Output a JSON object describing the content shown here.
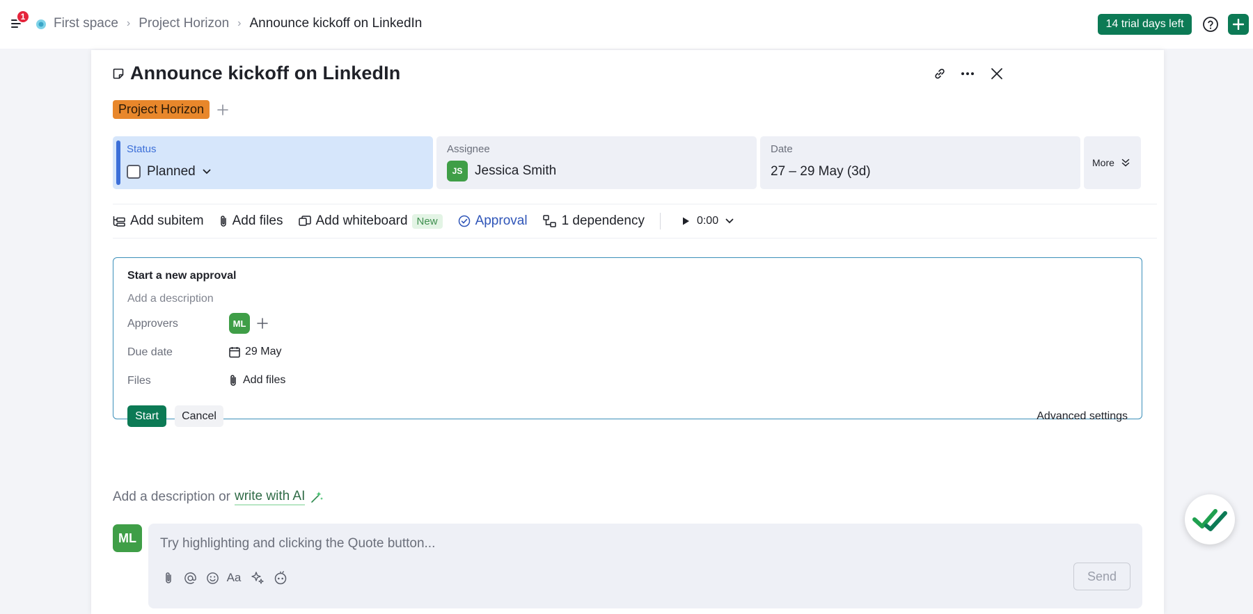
{
  "topbar": {
    "notification_count": "1",
    "breadcrumb": [
      "First space",
      "Project Horizon",
      "Announce kickoff on LinkedIn"
    ],
    "trial_label": "14 trial days left"
  },
  "task": {
    "title": "Announce kickoff on LinkedIn",
    "tag": "Project Horizon",
    "tag_color": "#e8872b"
  },
  "fields": {
    "status": {
      "label": "Status",
      "value": "Planned"
    },
    "assignee": {
      "label": "Assignee",
      "initials": "JS",
      "value": "Jessica Smith"
    },
    "date": {
      "label": "Date",
      "value": "27 – 29 May (3d)"
    },
    "more": {
      "label": "More"
    }
  },
  "toolbar": {
    "add_subitem": "Add subitem",
    "add_files": "Add files",
    "add_whiteboard": "Add whiteboard",
    "new_badge": "New",
    "approval": "Approval",
    "dependency": "1 dependency",
    "timer": "0:00"
  },
  "approval": {
    "title": "Start a new approval",
    "description_placeholder": "Add a description",
    "approvers_label": "Approvers",
    "approver_initials": "ML",
    "due_date_label": "Due date",
    "due_date_value": "29 May",
    "files_label": "Files",
    "files_value": "Add files",
    "start_label": "Start",
    "cancel_label": "Cancel",
    "advanced_label": "Advanced settings"
  },
  "description": {
    "prefix": "Add a description or",
    "ai_link": "write with AI"
  },
  "comment": {
    "avatar_initials": "ML",
    "placeholder": "Try highlighting and clicking the Quote button...",
    "send_label": "Send"
  },
  "colors": {
    "brand_green": "#0c7a55",
    "status_blue": "#3c6fd8",
    "approval_border": "#3b8fb9"
  }
}
